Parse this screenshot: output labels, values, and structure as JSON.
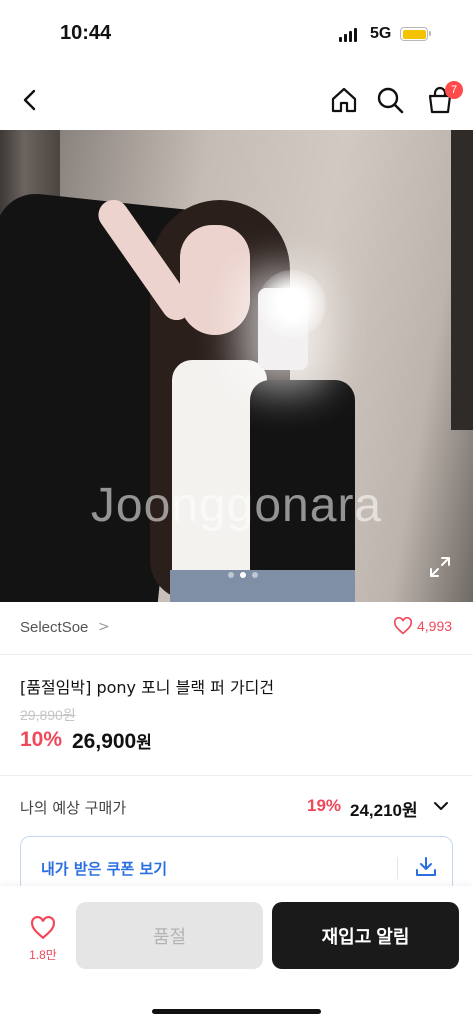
{
  "status": {
    "time": "10:44",
    "network": "5G"
  },
  "nav": {
    "cart_badge": "7"
  },
  "hero": {
    "watermark": "Joonggonara",
    "image_count": 3,
    "active_index": 1
  },
  "seller": {
    "name": "SelectSoe",
    "likes": "4,993"
  },
  "product": {
    "title": "[품절임박] pony 포니 블랙 퍼 가디건",
    "original_price": "29,890원",
    "discount": "10%",
    "price": "26,900",
    "price_unit": "원"
  },
  "expected": {
    "label": "나의 예상 구매가",
    "discount": "19%",
    "price": "24,210원"
  },
  "coupon": {
    "label": "내가 받은 쿠폰 보기"
  },
  "bottom": {
    "wish_count": "1.8만",
    "soldout_label": "품절",
    "restock_label": "재입고 알림"
  },
  "colors": {
    "accent": "#f0485a",
    "link": "#2a6fe0",
    "dark_button": "#1a1a1a"
  }
}
